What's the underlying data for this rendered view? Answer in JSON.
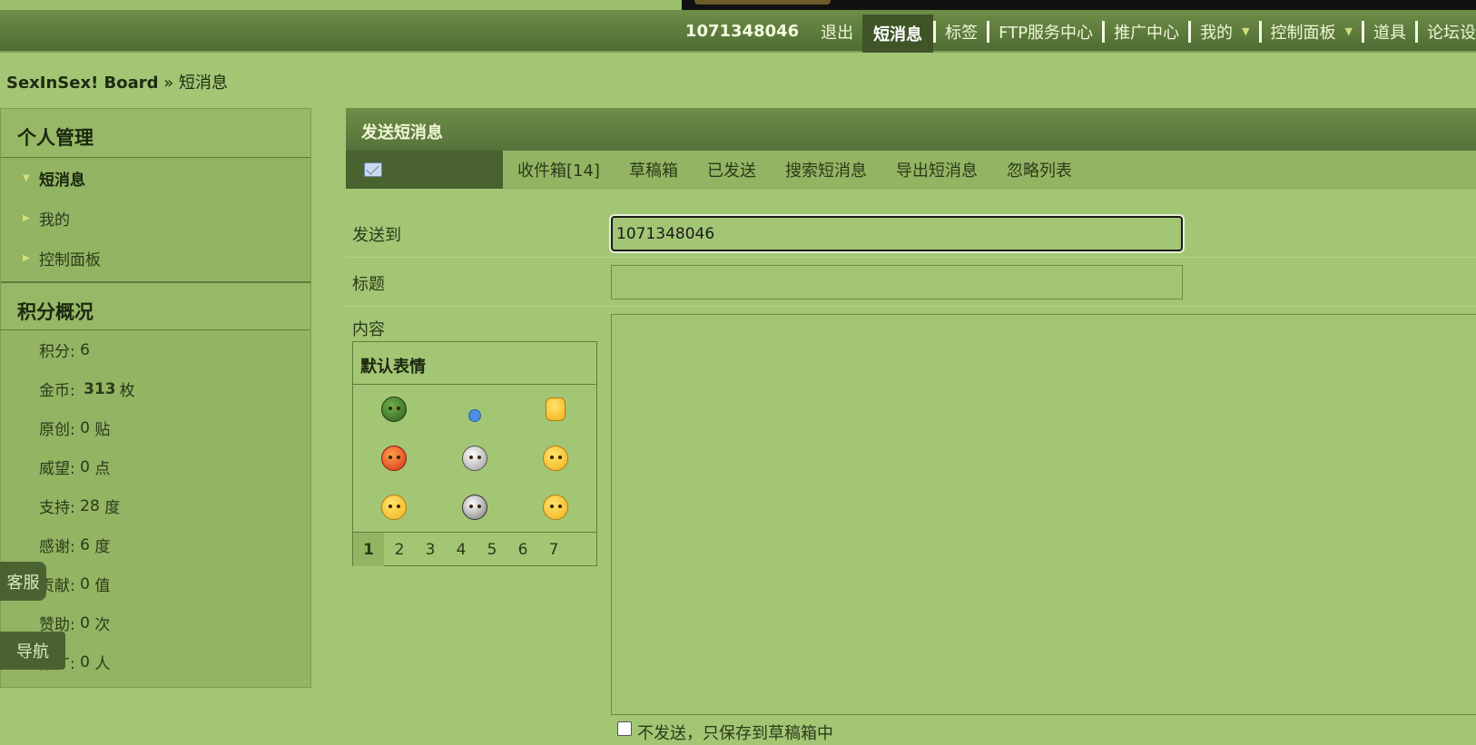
{
  "topnav": {
    "user": "1071348046",
    "logout": "退出",
    "messages": "短消息",
    "tags": "标签",
    "ftp": "FTP服务中心",
    "promo": "推广中心",
    "mine": "我的",
    "control": "控制面板",
    "props": "道具",
    "forum_settings": "论坛设"
  },
  "breadcrumb": {
    "board": "SexInSex! Board",
    "sep": "»",
    "current": "短消息"
  },
  "sidebar": {
    "personal_title": "个人管理",
    "items": [
      {
        "label": "短消息"
      },
      {
        "label": "我的"
      },
      {
        "label": "控制面板"
      }
    ],
    "points_title": "积分概况",
    "stats": [
      {
        "label": "积分:",
        "value": "6",
        "unit": ""
      },
      {
        "label": "金币:",
        "value": "313",
        "unit": "枚"
      },
      {
        "label": "原创:",
        "value": "0",
        "unit": "贴"
      },
      {
        "label": "威望:",
        "value": "0",
        "unit": "点"
      },
      {
        "label": "支持:",
        "value": "28",
        "unit": "度"
      },
      {
        "label": "感谢:",
        "value": "6",
        "unit": "度"
      },
      {
        "label": "贡献:",
        "value": "0",
        "unit": "值"
      },
      {
        "label": "赞助:",
        "value": "0",
        "unit": "次"
      },
      {
        "label": "推广:",
        "value": "0",
        "unit": "人"
      }
    ]
  },
  "float_buttons": {
    "kefu": "客服",
    "daohang": "导航"
  },
  "panel": {
    "title": "发送短消息",
    "tabs": [
      "收件箱[14]",
      "草稿箱",
      "已发送",
      "搜索短消息",
      "导出短消息",
      "忽略列表"
    ]
  },
  "form": {
    "to_label": "发送到",
    "to_value": "1071348046",
    "subject_label": "标题",
    "subject_value": "",
    "content_label": "内容",
    "no_send_label": "不发送，只保存到草稿箱中"
  },
  "smilies": {
    "title": "默认表情",
    "icons": [
      "soldier-smiley-icon",
      "music-note-icon",
      "thumbs-up-icon",
      "angry-smiley-icon",
      "skull-icon",
      "cool-smiley-icon",
      "frown-smiley-icon",
      "soccer-ball-icon",
      "sleepy-smiley-icon"
    ],
    "pages": [
      "1",
      "2",
      "3",
      "4",
      "5",
      "6",
      "7"
    ],
    "current_page": "1"
  }
}
